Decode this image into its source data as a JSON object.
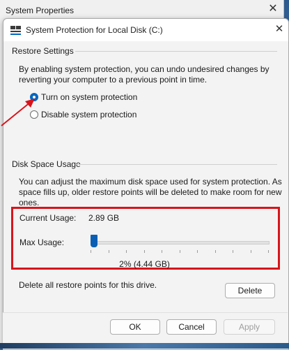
{
  "parent_window": {
    "title": "System Properties",
    "close_glyph": "✕"
  },
  "dialog": {
    "title": "System Protection for Local Disk (C:)",
    "close_glyph": "✕"
  },
  "restore_settings": {
    "heading": "Restore Settings",
    "description_line1": "By enabling system protection, you can undo undesired changes by",
    "description_line2": "reverting your computer to a previous point in time.",
    "options": [
      {
        "label": "Turn on system protection",
        "checked": true
      },
      {
        "label": "Disable system protection",
        "checked": false
      }
    ]
  },
  "disk_space": {
    "heading": "Disk Space Usage",
    "description_line1": "You can adjust the maximum disk space used for system protection. As",
    "description_line2": "space fills up, older restore points will be deleted to make room for new",
    "description_line3": "ones.",
    "current_usage_label": "Current Usage:",
    "current_usage_value": "2.89 GB",
    "max_usage_label": "Max Usage:",
    "max_usage_percent": 2,
    "max_usage_display": "2% (4.44 GB)"
  },
  "delete_section": {
    "text": "Delete all restore points for this drive.",
    "button_label": "Delete"
  },
  "footer": {
    "ok_label": "OK",
    "cancel_label": "Cancel",
    "apply_label": "Apply"
  },
  "colors": {
    "accent": "#0067c0",
    "highlight": "#d8141b",
    "annotation_arrow": "#d8141b"
  }
}
